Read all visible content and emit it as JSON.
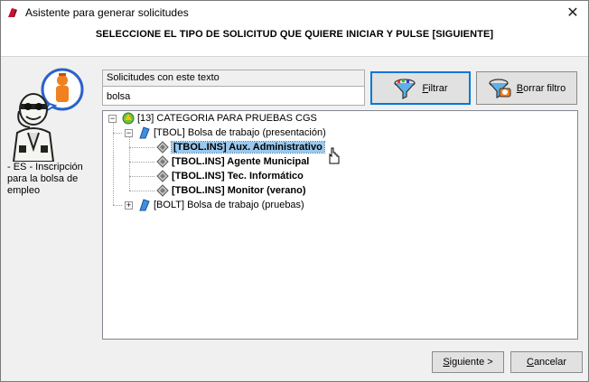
{
  "window": {
    "title": "Asistente para generar solicitudes",
    "close_glyph": "✕",
    "app_icon": "wizard-app-icon"
  },
  "header": {
    "instruction": "SELECCIONE EL TIPO DE SOLICITUD QUE QUIERE INICIAR Y PULSE [SIGUIENTE]"
  },
  "left_panel": {
    "description": "- ES - Inscripción para la bolsa de empleo"
  },
  "filter": {
    "label": "Solicitudes con este texto",
    "value": "bolsa",
    "filter_button": {
      "label_first": "F",
      "label_rest": "iltrar",
      "icon": "funnel-icon"
    },
    "clear_button": {
      "label_first": "B",
      "label_rest": "orrar filtro",
      "icon": "eraser-icon"
    }
  },
  "tree": {
    "root": {
      "label": "[13] CATEGORIA PARA PRUEBAS CGS",
      "expanded": true
    },
    "groups": [
      {
        "label": "[TBOL] Bolsa de trabajo (presentación)",
        "expanded": true,
        "items": [
          {
            "label": "[TBOL.INS] Aux. Administrativo",
            "selected": true
          },
          {
            "label": "[TBOL.INS] Agente Municipal",
            "selected": false
          },
          {
            "label": "[TBOL.INS] Tec. Informático",
            "selected": false
          },
          {
            "label": "[TBOL.INS] Monitor (verano)",
            "selected": false
          }
        ]
      },
      {
        "label": "[BOLT] Bolsa de trabajo (pruebas)",
        "expanded": false,
        "items": []
      }
    ]
  },
  "footer": {
    "next_button": {
      "label_first": "S",
      "label_rest": "iguiente >"
    },
    "cancel_button": {
      "label_first": "C",
      "label_rest": "ancelar"
    }
  },
  "colors": {
    "selection": "#99c9ef",
    "focus_border": "#0078d7"
  }
}
